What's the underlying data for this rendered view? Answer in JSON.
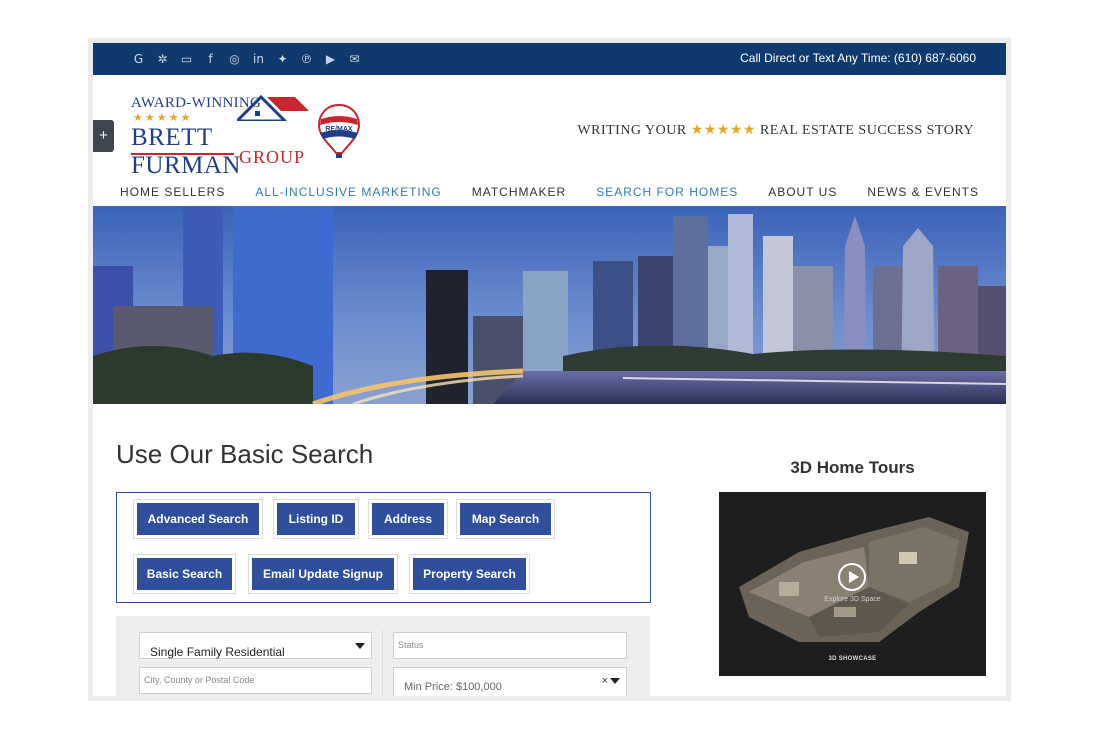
{
  "topbar": {
    "social_icons": [
      "google-icon",
      "yelp-icon",
      "chat-icon",
      "facebook-icon",
      "instagram-icon",
      "linkedin-icon",
      "twitter-icon",
      "pinterest-icon",
      "youtube-icon",
      "email-icon"
    ],
    "social_glyphs": [
      "G",
      "✲",
      "▭",
      "f",
      "◎",
      "in",
      "✦",
      "℗",
      "▶",
      "✉"
    ],
    "phone_text": "Call Direct or Text Any Time: (610) 687-6060"
  },
  "header": {
    "plus_label": "+",
    "logo": {
      "award": "AWARD-WINNING",
      "stars": "★★★★★",
      "name": "BRETT FURMAN",
      "group": "GROUP"
    },
    "balloon_brand": "RE/MAX",
    "tagline": {
      "before": "WRITING YOUR ",
      "stars": "★★★★★",
      "after": " REAL ESTATE SUCCESS STORY"
    }
  },
  "nav": {
    "items": [
      {
        "label": "HOME SELLERS",
        "highlight": false
      },
      {
        "label": "ALL-INCLUSIVE MARKETING",
        "highlight": true
      },
      {
        "label": "MATCHMAKER",
        "highlight": false
      },
      {
        "label": "SEARCH FOR HOMES",
        "highlight": true
      },
      {
        "label": "ABOUT US",
        "highlight": false
      },
      {
        "label": "NEWS & EVENTS",
        "highlight": false
      }
    ]
  },
  "main": {
    "title": "Use Our Basic Search",
    "buttons": [
      "Advanced Search",
      "Listing ID",
      "Address",
      "Map Search",
      "Basic Search",
      "Email Update Signup",
      "Property Search"
    ],
    "form": {
      "property_type_value": "Single Family Residential",
      "status_placeholder": "Status",
      "location_placeholder": "City, County or Postal Code",
      "min_price_value": "Min Price: $100,000",
      "clear_glyph": "×"
    }
  },
  "tours": {
    "title": "3D Home Tours",
    "explore_text": "Explore 3D Space",
    "badge_text": "3D SHOWCASE"
  },
  "colors": {
    "navy": "#0f3a6e",
    "button_blue": "#2f4f9c",
    "accent_red": "#c8262e",
    "star_gold": "#e5a623",
    "nav_highlight": "#2c7fa8"
  }
}
